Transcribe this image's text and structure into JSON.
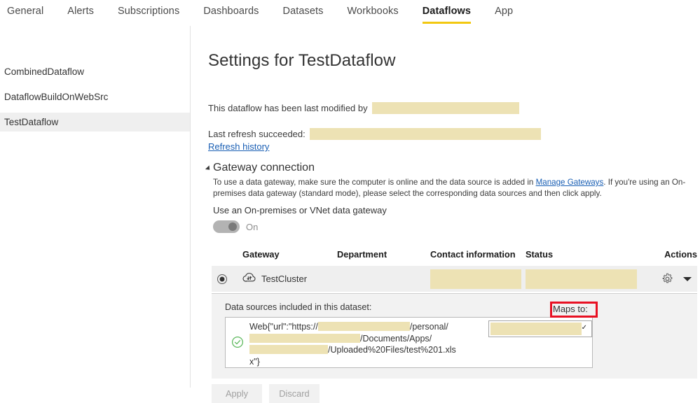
{
  "topnav": {
    "tabs": [
      {
        "label": "General",
        "active": false
      },
      {
        "label": "Alerts",
        "active": false
      },
      {
        "label": "Subscriptions",
        "active": false
      },
      {
        "label": "Dashboards",
        "active": false
      },
      {
        "label": "Datasets",
        "active": false
      },
      {
        "label": "Workbooks",
        "active": false
      },
      {
        "label": "Dataflows",
        "active": true
      },
      {
        "label": "App",
        "active": false
      }
    ],
    "active_underline_color": "#f2c811"
  },
  "sidebar": {
    "items": [
      {
        "label": "CombinedDataflow",
        "selected": false
      },
      {
        "label": "DataflowBuildOnWebSrc",
        "selected": false
      },
      {
        "label": "TestDataflow",
        "selected": true
      }
    ],
    "selected_background": "#efefef"
  },
  "main": {
    "page_title": "Settings for TestDataflow",
    "modified_text": "This dataflow has been last modified by",
    "modified_value_redacted": true,
    "refresh_status_text": "Last refresh succeeded:",
    "refresh_value_redacted": true,
    "refresh_history_link": "Refresh history",
    "redaction_color": "#ede2b4"
  },
  "gateway_section": {
    "title": "Gateway connection",
    "description_part1": "To use a data gateway, make sure the computer is online and the data source is added in ",
    "description_link": "Manage Gateways",
    "description_part2": ". If you're using an On-premises data gateway (standard mode), please select the corresponding data sources and then click apply.",
    "use_gateway_label": "Use an On-premises or VNet data gateway",
    "toggle_state_label": "On",
    "toggle_on": true
  },
  "gateway_table": {
    "columns": [
      "Gateway",
      "Department",
      "Contact information",
      "Status",
      "Actions"
    ],
    "rows": [
      {
        "selected": true,
        "gateway_name": "TestCluster",
        "department": "",
        "contact_information_redacted": true,
        "status_redacted": true,
        "actions": [
          "gear-icon",
          "chevron-down-icon"
        ]
      }
    ]
  },
  "data_sources": {
    "title": "Data sources included in this dataset:",
    "entry": {
      "status": "valid",
      "text_seg_1": "Web{\"url\":\"https://",
      "text_seg_2": "/pe",
      "text_seg_3": "rsonal/",
      "text_seg_4": "/Docume",
      "text_seg_5": "nts/Apps/",
      "text_seg_6": "/Uploaded%20File",
      "text_seg_7": "s/test%201.xlsx\"}"
    },
    "maps_to_label": "Maps to:",
    "maps_to_value_redacted": true,
    "highlight_color": "#e81123"
  },
  "footer": {
    "apply_label": "Apply",
    "discard_label": "Discard",
    "buttons_disabled": true
  }
}
